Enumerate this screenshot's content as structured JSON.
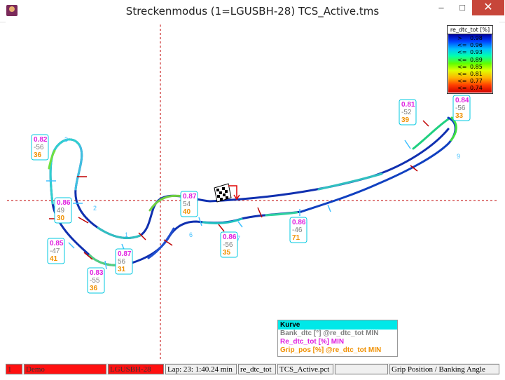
{
  "window": {
    "title": "Streckenmodus (1=LGUSBH-28)   TCS_Active.tms",
    "min_glyph": "–",
    "max_glyph": "□",
    "close_glyph": "✕"
  },
  "legend": {
    "title": "re_dtc_tot [%]",
    "rows": [
      {
        "op": ">",
        "value": "0.98"
      },
      {
        "op": "<=",
        "value": "0.96"
      },
      {
        "op": "<=",
        "value": "0.93"
      },
      {
        "op": "<=",
        "value": "0.89"
      },
      {
        "op": "<=",
        "value": "0.85"
      },
      {
        "op": "<=",
        "value": "0.81"
      },
      {
        "op": "<=",
        "value": "0.77"
      },
      {
        "op": "<=",
        "value": "0.74"
      }
    ]
  },
  "corners": [
    {
      "re": "0.82",
      "bank": "-56",
      "grip": "36",
      "num": "3"
    },
    {
      "re": "0.86",
      "bank": "49",
      "grip": "30",
      "num": "2"
    },
    {
      "re": "0.85",
      "bank": "-47",
      "grip": "41",
      "num": ""
    },
    {
      "re": "0.87",
      "bank": "56",
      "grip": "31",
      "num": "1"
    },
    {
      "re": "0.83",
      "bank": "-55",
      "grip": "36",
      "num": ""
    },
    {
      "re": "0.87",
      "bank": "54",
      "grip": "40",
      "num": ""
    },
    {
      "re": "0.86",
      "bank": "-56",
      "grip": "35",
      "num": "7"
    },
    {
      "re": "0.86",
      "bank": "-46",
      "grip": "71",
      "num": ""
    },
    {
      "re": "0.81",
      "bank": "-52",
      "grip": "39",
      "num": ""
    },
    {
      "re": "0.84",
      "bank": "-56",
      "grip": "33",
      "num": ""
    }
  ],
  "turn_labels": {
    "t6": "6",
    "t9": "9"
  },
  "kurve_box": {
    "header": "Kurve",
    "rows": [
      {
        "text": "Bank_dtc [°] @re_dtc_tot MIN",
        "color": "#808080"
      },
      {
        "text": "Re_dtc_tot [%] MIN",
        "color": "#e020e0"
      },
      {
        "text": "Grip_pos [%] @re_dtc_tot MIN",
        "color": "#f09000"
      }
    ]
  },
  "status": {
    "num": "1",
    "mode": "Demo",
    "car": "LGUSBH-28",
    "lap": "Lap: 23: 1:40.24 min",
    "channel": "re_dtc_tot",
    "file": "TCS_Active.pct",
    "view": "Grip Position / Banking Angle"
  },
  "colors": {
    "re": "#e020e0",
    "bank": "#808080",
    "grip": "#f09000",
    "box_border": "#00c8e0",
    "crosshair": "#c00000",
    "track_dark": "#1030b0",
    "marker": "#c00000",
    "tick": "#40c0ff"
  }
}
